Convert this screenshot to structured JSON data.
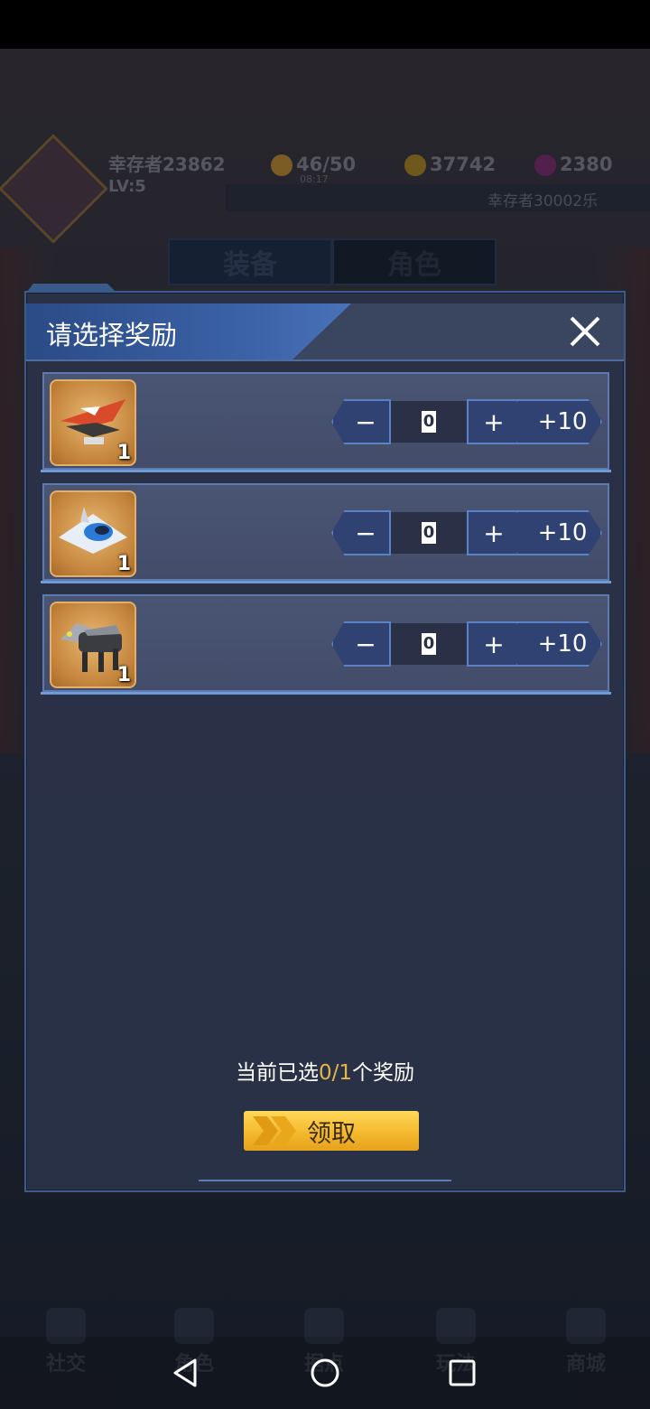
{
  "background": {
    "player_name": "幸存者23862",
    "player_level": "LV:5",
    "energy": "46/50",
    "energy_timer": "08:17",
    "gold": "37742",
    "gems": "2380",
    "server_player": "幸存者30002乐",
    "tabs": [
      "装备",
      "角色"
    ],
    "bottom_nav": [
      {
        "label": "社交",
        "icon": "social-icon"
      },
      {
        "label": "角色",
        "icon": "character-icon"
      },
      {
        "label": "据点",
        "icon": "location-icon"
      },
      {
        "label": "玩法",
        "icon": "gamepad-icon"
      },
      {
        "label": "商城",
        "icon": "cart-icon"
      }
    ]
  },
  "dialog": {
    "title": "请选择奖励",
    "items": [
      {
        "name": "red-aircraft",
        "count": "1",
        "quantity": "0",
        "minus": "−",
        "plus": "+",
        "plus10": "+10"
      },
      {
        "name": "white-aircraft",
        "count": "1",
        "quantity": "0",
        "minus": "−",
        "plus": "+",
        "plus10": "+10"
      },
      {
        "name": "mech-beast",
        "count": "1",
        "quantity": "0",
        "minus": "−",
        "plus": "+",
        "plus10": "+10"
      }
    ],
    "summary_prefix": "当前已选",
    "summary_value": "0/1",
    "summary_suffix": "个奖励",
    "claim_label": "领取"
  },
  "colors": {
    "accent_gold": "#e7b64a",
    "button_blue": "#2f4272",
    "header_blue": "#3c63a8"
  }
}
